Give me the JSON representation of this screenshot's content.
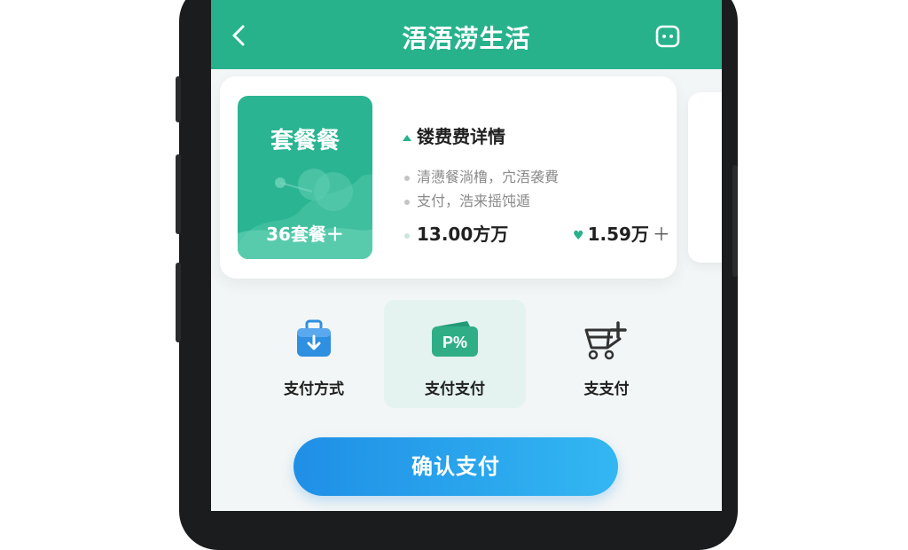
{
  "header": {
    "title": "浯浯涝生活"
  },
  "package_card": {
    "tile_title": "套餐餐",
    "tile_subtitle": "36套餐＋",
    "detail_title": "镂费费详情",
    "bullets": [
      "清懑餐淌橹，宂浯袭費",
      "支付，浩来摇饨遁"
    ],
    "price_left": "13.00方万",
    "price_right": "1.59万",
    "price_right_suffix": "＋"
  },
  "actions": [
    {
      "label": "支付方式",
      "icon": "briefcase-download-icon"
    },
    {
      "label": "支付支付",
      "icon": "wallet-percent-icon",
      "icon_text": "P%"
    },
    {
      "label": "支支付",
      "icon": "cart-plus-icon"
    }
  ],
  "confirm_button": {
    "label": "确认支付"
  },
  "colors": {
    "header": "#27b28c",
    "accent_green": "#27b28c",
    "button_start": "#1f8fe6",
    "button_end": "#33b7f2"
  }
}
